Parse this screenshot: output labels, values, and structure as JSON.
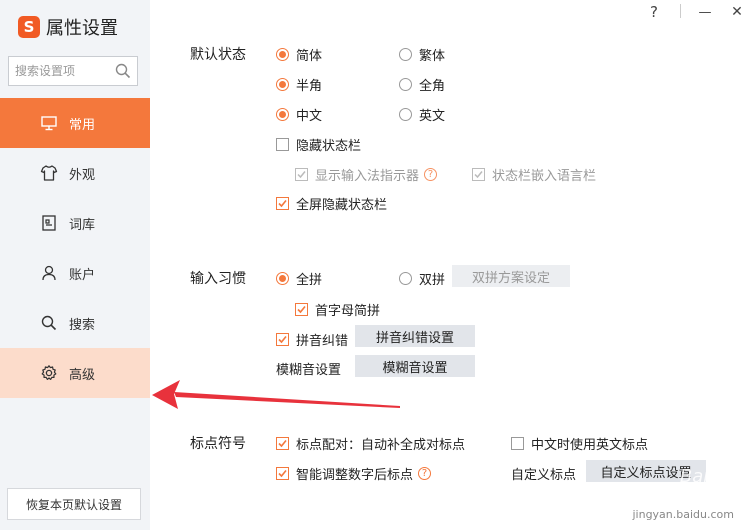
{
  "window": {
    "title": "属性设置",
    "help_label": "?",
    "min_label": "—",
    "close_label": "✕"
  },
  "colors": {
    "accent": "#f4783c",
    "sidebar_bg": "#f2f4f7",
    "hover": "#fcdccb"
  },
  "sidebar": {
    "search_placeholder": "搜索设置项",
    "items": [
      {
        "label": "常用",
        "icon": "monitor-icon",
        "state": "active"
      },
      {
        "label": "外观",
        "icon": "shirt-icon"
      },
      {
        "label": "词库",
        "icon": "book-icon"
      },
      {
        "label": "账户",
        "icon": "user-icon"
      },
      {
        "label": "搜索",
        "icon": "search-icon"
      },
      {
        "label": "高级",
        "icon": "gear-icon",
        "state": "hover"
      }
    ],
    "restore_label": "恢复本页默认设置"
  },
  "default_state": {
    "heading": "默认状态",
    "simplified": "简体",
    "traditional": "繁体",
    "half_width": "半角",
    "full_width": "全角",
    "chinese": "中文",
    "english": "英文",
    "hide_status_bar": "隐藏状态栏",
    "show_indicator": "显示输入法指示器",
    "embed_lang_bar": "状态栏嵌入语言栏",
    "fullscreen_hide": "全屏隐藏状态栏"
  },
  "input_habit": {
    "heading": "输入习惯",
    "quanpin": "全拼",
    "shuangpin": "双拼",
    "shuangpin_button": "双拼方案设定",
    "initial_abbrev": "首字母简拼",
    "pinyin_correct": "拼音纠错",
    "pinyin_correct_button": "拼音纠错设置",
    "fuzzy_label": "模糊音设置",
    "fuzzy_button": "模糊音设置"
  },
  "punctuation": {
    "heading": "标点符号",
    "auto_pair": "标点配对：自动补全成对标点",
    "english_in_chinese": "中文时使用英文标点",
    "smart_number": "智能调整数字后标点",
    "custom_label": "自定义标点",
    "custom_button": "自定义标点设置"
  },
  "watermark": {
    "text": "Bai 经验",
    "url": "jingyan.baidu.com"
  }
}
